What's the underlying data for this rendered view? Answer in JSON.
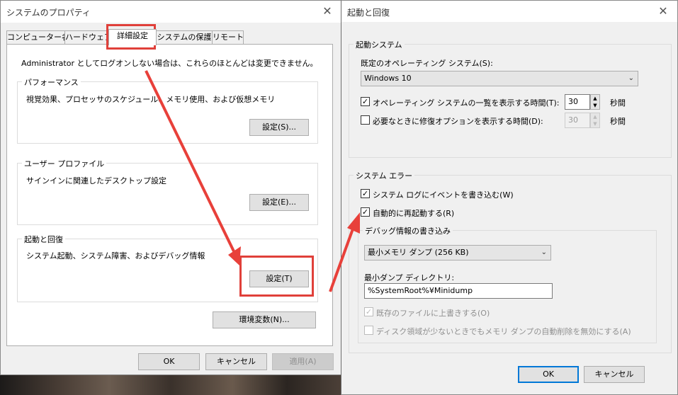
{
  "system_properties": {
    "title": "システムのプロパティ",
    "tabs": [
      "コンピューター名",
      "ハードウェア",
      "詳細設定",
      "システムの保護",
      "リモート"
    ],
    "active_tab": "詳細設定",
    "admin_note": "Administrator としてログオンしない場合は、これらのほとんどは変更できません。",
    "performance": {
      "title": "パフォーマンス",
      "desc": "視覚効果、プロセッサのスケジュール、メモリ使用、および仮想メモリ",
      "button": "設定(S)..."
    },
    "user_profile": {
      "title": "ユーザー プロファイル",
      "desc": "サインインに関連したデスクトップ設定",
      "button": "設定(E)..."
    },
    "startup_recovery": {
      "title": "起動と回復",
      "desc": "システム起動、システム障害、およびデバッグ情報",
      "button": "設定(T)"
    },
    "env_button": "環境変数(N)...",
    "ok": "OK",
    "cancel": "キャンセル",
    "apply": "適用(A)"
  },
  "startup_recovery_dialog": {
    "title": "起動と回復",
    "system_startup": {
      "title": "起動システム",
      "default_os_label": "既定のオペレーティング システム(S):",
      "default_os_value": "Windows 10",
      "show_os_list_label": "オペレーティング システムの一覧を表示する時間(T):",
      "show_os_list_checked": true,
      "show_os_list_value": "30",
      "show_recovery_label": "必要なときに修復オプションを表示する時間(D):",
      "show_recovery_checked": false,
      "show_recovery_value": "30",
      "seconds": "秒間"
    },
    "system_failure": {
      "title": "システム エラー",
      "write_event_label": "システム ログにイベントを書き込む(W)",
      "write_event_checked": true,
      "auto_restart_label": "自動的に再起動する(R)",
      "auto_restart_checked": true,
      "debug_info": {
        "title": "デバッグ情報の書き込み",
        "dump_type": "最小メモリ ダンプ (256 KB)",
        "dump_dir_label": "最小ダンプ ディレクトリ:",
        "dump_dir_value": "%SystemRoot%¥Minidump",
        "overwrite_label": "既存のファイルに上書きする(O)",
        "overwrite_checked": true,
        "disable_autodelete_label": "ディスク領域が少ないときでもメモリ ダンプの自動削除を無効にする(A)",
        "disable_autodelete_checked": false
      }
    },
    "ok": "OK",
    "cancel": "キャンセル"
  },
  "check_mark": "✓",
  "close_glyph": "✕",
  "spin_up": "▲",
  "spin_down": "▼",
  "chevron": "⌄",
  "colors": {
    "highlight": "#e0403a",
    "focus": "#0078d7"
  }
}
